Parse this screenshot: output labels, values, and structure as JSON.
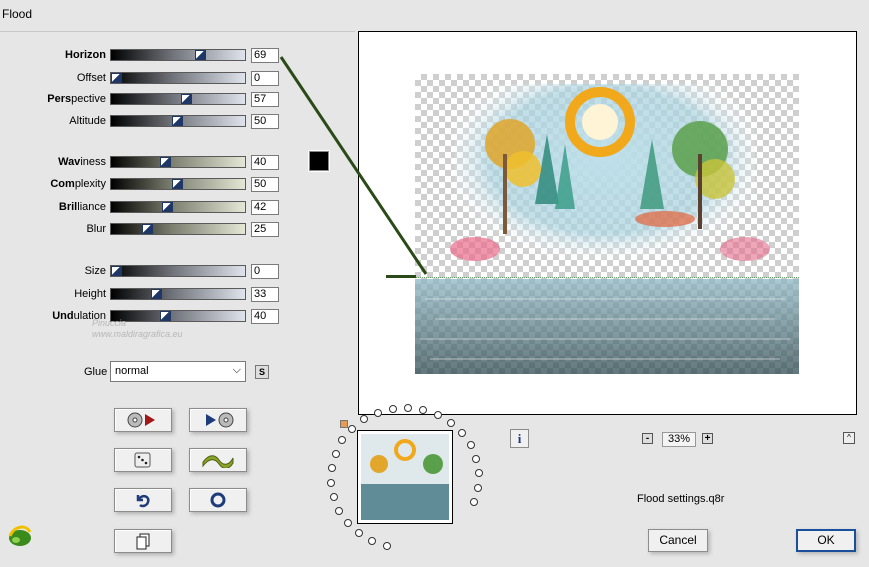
{
  "window": {
    "title": "Flood"
  },
  "params": [
    {
      "id": "horizon",
      "bold": "Horizon",
      "rest": "",
      "value": "69",
      "fraction": 0.69,
      "track": "gray"
    },
    {
      "id": "offset",
      "bold": "",
      "rest": "Offset",
      "value": "0",
      "fraction": 0.0,
      "track": "gray"
    },
    {
      "id": "perspective",
      "bold": "Pers",
      "rest": "pective",
      "value": "57",
      "fraction": 0.57,
      "track": "gray"
    },
    {
      "id": "altitude",
      "bold": "",
      "rest": "Altitude",
      "value": "50",
      "fraction": 0.5,
      "track": "gray"
    },
    {
      "id": "waviness",
      "bold": "Wav",
      "rest": "iness",
      "value": "40",
      "fraction": 0.4,
      "track": "sage"
    },
    {
      "id": "complexity",
      "bold": "Com",
      "rest": "plexity",
      "value": "50",
      "fraction": 0.5,
      "track": "sage"
    },
    {
      "id": "brilliance",
      "bold": "Bril",
      "rest": "liance",
      "value": "42",
      "fraction": 0.42,
      "track": "sage"
    },
    {
      "id": "blur",
      "bold": "",
      "rest": "Blur",
      "value": "25",
      "fraction": 0.25,
      "track": "sage"
    },
    {
      "id": "size",
      "bold": "",
      "rest": "Size",
      "value": "0",
      "fraction": 0.0,
      "track": "gray"
    },
    {
      "id": "height",
      "bold": "",
      "rest": "Height",
      "value": "33",
      "fraction": 0.33,
      "track": "gray"
    },
    {
      "id": "undulation",
      "bold": "Und",
      "rest": "ulation",
      "value": "40",
      "fraction": 0.4,
      "track": "gray"
    }
  ],
  "glue": {
    "label": "Glue",
    "selected": "normal",
    "side_button": "S"
  },
  "color_swatch": "#000000",
  "watermark": {
    "line1": "Pinuccia",
    "line2": "www.maldiragrafica.eu"
  },
  "zoom": {
    "value": "33%",
    "minus": "-",
    "plus": "+"
  },
  "info_label": "i",
  "caret_label": "^",
  "settings_file": "Flood settings.q8r",
  "buttons": {
    "cancel": "Cancel",
    "ok": "OK"
  },
  "accent_colors": {
    "slider_thumb": "#1e3766",
    "pointer_line": "#2a4a18",
    "ok_border": "#1a4f9c"
  }
}
